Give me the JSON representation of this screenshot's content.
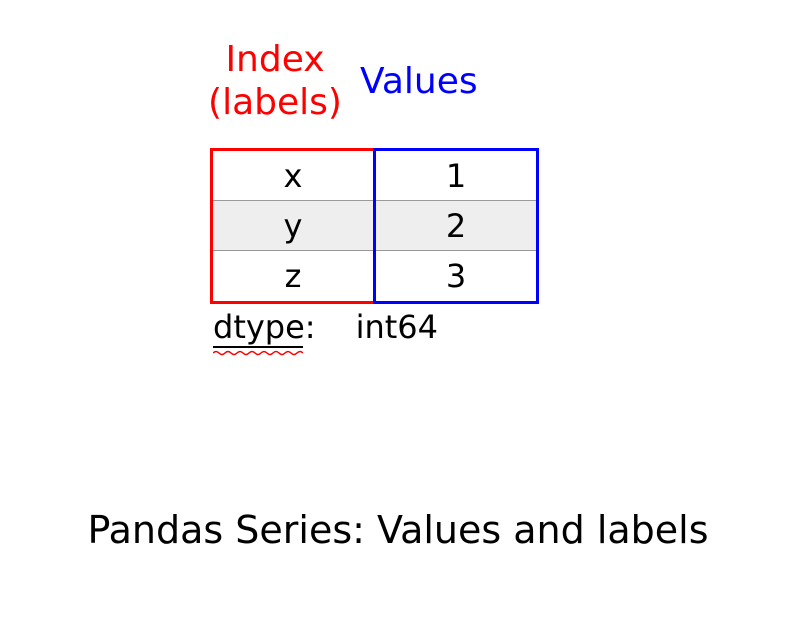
{
  "headers": {
    "index_line1": "Index",
    "index_line2": "(labels)",
    "values": "Values"
  },
  "chart_data": {
    "type": "table",
    "index": [
      "x",
      "y",
      "z"
    ],
    "values": [
      1,
      2,
      3
    ],
    "dtype": "int64"
  },
  "dtype_label": "dtype:",
  "caption": "Pandas Series: Values and labels"
}
